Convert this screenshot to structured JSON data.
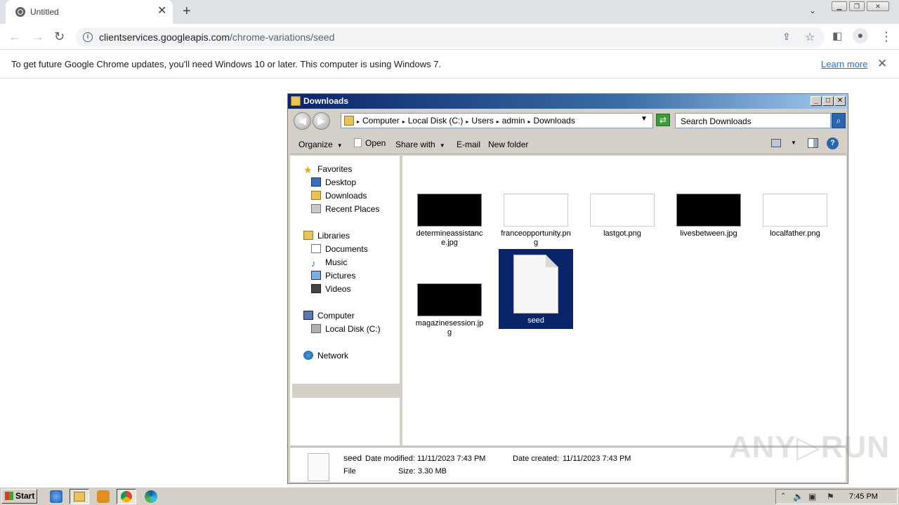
{
  "browser": {
    "tab_title": "Untitled",
    "tab_close": "✕",
    "new_tab": "+",
    "tab_list": "⌄",
    "url_host": "clientservices.googleapis.com",
    "url_path": "/chrome-variations/seed",
    "infobar_message": "To get future Google Chrome updates, you'll need Windows 10 or later. This computer is using Windows 7.",
    "infobar_link": "Learn more",
    "infobar_close": "✕"
  },
  "explorer": {
    "title": "Downloads",
    "breadcrumbs": [
      "Computer",
      "Local Disk (C:)",
      "Users",
      "admin",
      "Downloads"
    ],
    "search_placeholder": "Search Downloads",
    "toolbar": {
      "organize": "Organize",
      "open": "Open",
      "share_with": "Share with",
      "email": "E-mail",
      "new_folder": "New folder"
    },
    "nav": {
      "favorites": "Favorites",
      "desktop": "Desktop",
      "downloads": "Downloads",
      "recent_places": "Recent Places",
      "libraries": "Libraries",
      "documents": "Documents",
      "music": "Music",
      "pictures": "Pictures",
      "videos": "Videos",
      "computer": "Computer",
      "local_disk": "Local Disk (C:)",
      "network": "Network"
    },
    "files": [
      {
        "name": "determineassistance.jpg",
        "thumb": "black"
      },
      {
        "name": "franceopportunity.png",
        "thumb": "white"
      },
      {
        "name": "lastgot.png",
        "thumb": "white"
      },
      {
        "name": "livesbetween.jpg",
        "thumb": "black"
      },
      {
        "name": "localfather.png",
        "thumb": "white"
      },
      {
        "name": "magazinesession.jpg",
        "thumb": "black"
      },
      {
        "name": "seed",
        "thumb": "file",
        "selected": true
      }
    ],
    "details": {
      "name": "seed",
      "type": "File",
      "modified_label": "Date modified:",
      "modified_value": "11/11/2023 7:43 PM",
      "created_label": "Date created:",
      "created_value": "11/11/2023 7:43 PM",
      "size_label": "Size:",
      "size_value": "3.30 MB"
    }
  },
  "taskbar": {
    "start": "Start",
    "clock": "7:45 PM"
  },
  "watermark": "ANY▷RUN",
  "colors": {
    "selection": "#0a246a",
    "link": "#1a73e8",
    "titlebar": "#0a246a"
  }
}
